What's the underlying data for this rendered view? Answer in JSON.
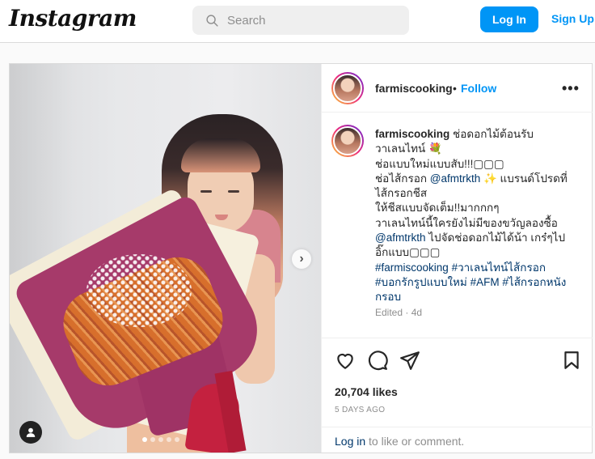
{
  "header": {
    "logo": "Instagram",
    "search_placeholder": "Search",
    "login_label": "Log In",
    "signup_label": "Sign Up"
  },
  "post": {
    "username": "farmiscooking",
    "bullet": "•",
    "follow_label": "Follow",
    "more_label": "•••",
    "caption": {
      "username": "farmiscooking",
      "line1": "ช่อดอกไม้ต้อนรับ",
      "line2": "วาเลนไทน์ 💐",
      "line3": "ช่อแบบใหม่แบบสับ!!!▢▢▢",
      "line4_pre": "ช่อไส้กรอก ",
      "mention1": "@afmtrkth",
      "line4_post": " ✨ แบรนด์โปรดที่",
      "line5": "ไส้กรอกชีส",
      "line6": "ให้ชีสแบบจัดเต็ม!!มากกกๆ",
      "line7": "วาเลนไทน์นี้ใครยังไม่มีของขวัญลองซื้อ",
      "mention2": "@afmtrkth",
      "line8_post": " ไปจัดช่อดอกไม้ได้น้า เกร๋ๆไป",
      "line9": "อิ๊กแบบ▢▢▢",
      "hashtag1": "#farmiscooking",
      "hashtag2": "#วาเลนไทน์ไส้กรอก",
      "hashtag3": "#บอกรักรูปแบบใหม่",
      "hashtag4": "#AFM",
      "hashtag5": "#ไส้กรอกหนัง",
      "hashtag5_cont": "กรอบ"
    },
    "edited_label": "Edited · 4d",
    "likes": "20,704 likes",
    "date": "5 DAYS AGO",
    "login_link": "Log in",
    "login_suffix": " to like or comment.",
    "next_arrow": "›",
    "carousel_count": 5,
    "carousel_active": 1
  },
  "icons": {
    "search": "search-icon",
    "heart": "heart-icon",
    "comment": "comment-icon",
    "share": "share-icon",
    "bookmark": "bookmark-icon",
    "user_tag": "user-tag-icon"
  }
}
